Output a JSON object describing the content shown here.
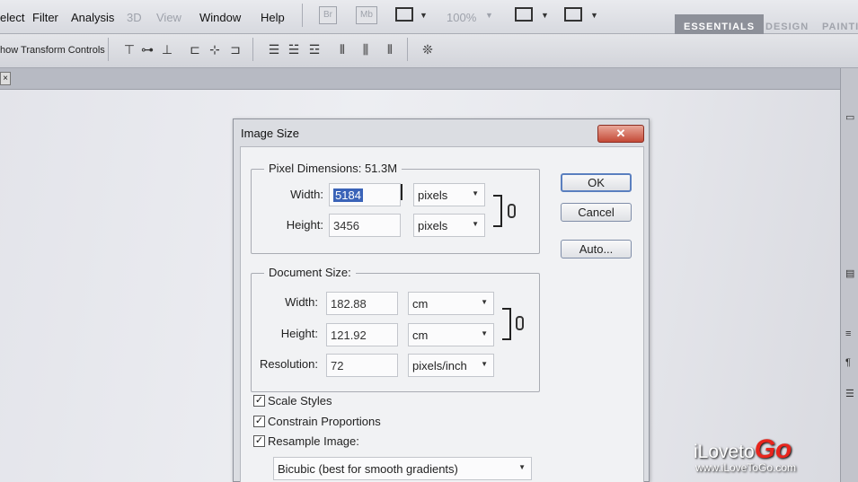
{
  "menubar": {
    "items": [
      "elect",
      "Filter",
      "Analysis",
      "3D",
      "View",
      "Window",
      "Help"
    ],
    "badges": [
      "Br",
      "Mb"
    ],
    "zoom": "100%",
    "workspaces": {
      "essentials": "ESSENTIALS",
      "design": "DESIGN",
      "painting": "PAINTIN"
    }
  },
  "options": {
    "show_transform_label": "how Transform Controls"
  },
  "dialog": {
    "title": "Image Size",
    "close_glyph": "✕",
    "pixel_dimensions": {
      "label": "Pixel Dimensions:",
      "size": "51.3M",
      "width_label": "Width:",
      "width_value": "5184",
      "width_unit": "pixels",
      "height_label": "Height:",
      "height_value": "3456",
      "height_unit": "pixels"
    },
    "document_size": {
      "label": "Document Size:",
      "width_label": "Width:",
      "width_value": "182.88",
      "width_unit": "cm",
      "height_label": "Height:",
      "height_value": "121.92",
      "height_unit": "cm",
      "resolution_label": "Resolution:",
      "resolution_value": "72",
      "resolution_unit": "pixels/inch"
    },
    "buttons": {
      "ok": "OK",
      "cancel": "Cancel",
      "auto": "Auto..."
    },
    "checkboxes": {
      "scale_styles": {
        "label": "Scale Styles",
        "checked": true
      },
      "constrain_proportions": {
        "label": "Constrain Proportions",
        "checked": true
      },
      "resample_image": {
        "label": "Resample Image:",
        "checked": true
      }
    },
    "resample_method": "Bicubic (best for smooth gradients)",
    "check_glyph": "✓"
  },
  "logo": {
    "prefix": "iLoveto",
    "go": "Go",
    "url": "www.iLoveToGo.com"
  },
  "colors": {
    "selection": "#3a63b8",
    "close_button": "#c44a37",
    "logo_accent": "#e8251d"
  }
}
